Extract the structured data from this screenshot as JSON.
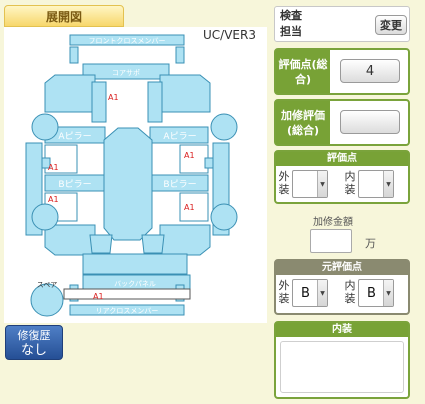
{
  "diagram_tab": {
    "label": "展開図"
  },
  "model": "UC/VER3",
  "diagram": {
    "parts": {
      "front_cross_member": "フロントクロスメンバー",
      "core_support": "コアサポ",
      "a_pillar_left": "Aピラー",
      "a_pillar_right": "Aピラー",
      "b_pillar_left": "Bピラー",
      "b_pillar_right": "Bピラー",
      "back_panel": "バックパネル",
      "rear_cross_member": "リアクロスメンバー",
      "spare": "スペア"
    },
    "marks": [
      "A1",
      "A1",
      "A1",
      "A1",
      "A1",
      "A1"
    ]
  },
  "repair_history": {
    "line1": "修復歴",
    "line2": "なし"
  },
  "inspector": {
    "label": "検査担当",
    "change_label": "変更"
  },
  "overall_score": {
    "label": "評価点(総合)",
    "value": "4"
  },
  "repair_score": {
    "label": "加修評価(総合)",
    "value": ""
  },
  "score": {
    "title": "評価点",
    "exterior_label": "外装",
    "exterior_value": "",
    "interior_label": "内装",
    "interior_value": ""
  },
  "extra_cost": {
    "title": "加修金額",
    "value": "",
    "unit": "万"
  },
  "original_score": {
    "title": "元評価点",
    "exterior_label": "外装",
    "exterior_value": "B",
    "interior_label": "内装",
    "interior_value": "B"
  },
  "interior": {
    "title": "内装",
    "text": ""
  },
  "colors": {
    "panel": "#aee2f3",
    "stroke": "#3a90b4",
    "accent_green": "#78a236"
  }
}
